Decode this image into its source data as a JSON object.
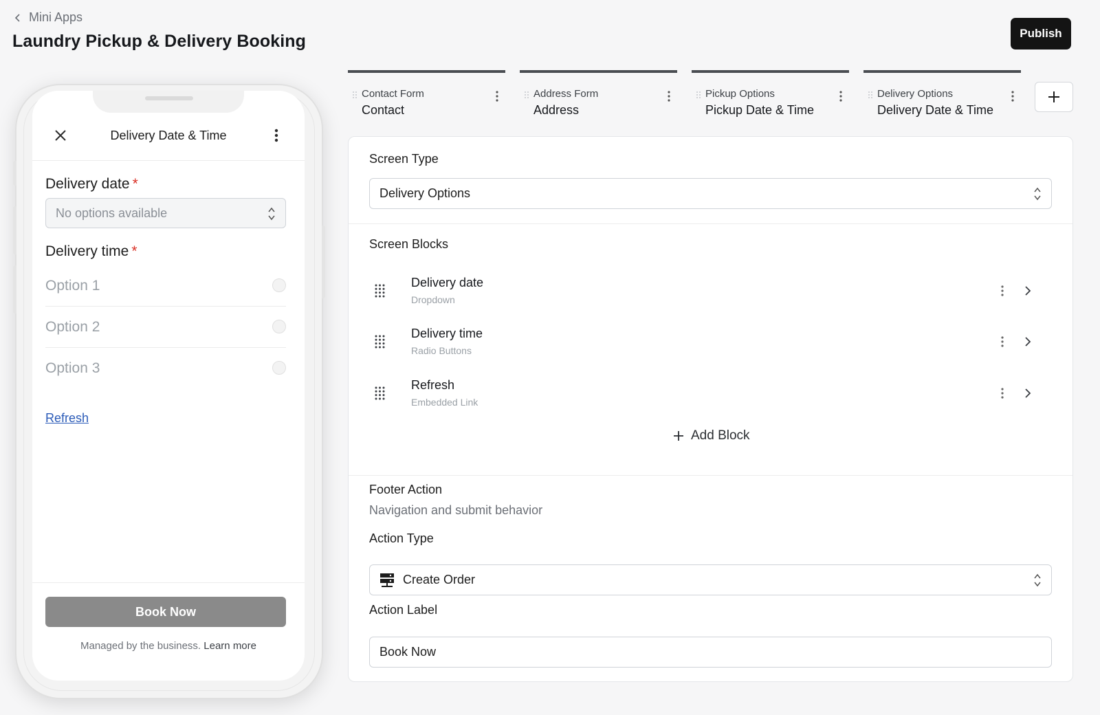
{
  "header": {
    "breadcrumb": "Mini Apps",
    "title": "Laundry Pickup & Delivery Booking",
    "publish_label": "Publish"
  },
  "phone": {
    "screen_title": "Delivery Date & Time",
    "delivery_date": {
      "label": "Delivery date",
      "required_mark": "*",
      "placeholder": "No options available"
    },
    "delivery_time": {
      "label": "Delivery time",
      "required_mark": "*",
      "options": [
        "Option 1",
        "Option 2",
        "Option 3"
      ]
    },
    "refresh_link": "Refresh",
    "book_button": "Book Now",
    "managed_text": "Managed by the business.",
    "learn_more": "Learn more"
  },
  "tabs": [
    {
      "sub": "Contact Form",
      "main": "Contact"
    },
    {
      "sub": "Address Form",
      "main": "Address"
    },
    {
      "sub": "Pickup Options",
      "main": "Pickup Date & Time"
    },
    {
      "sub": "Delivery Options",
      "main": "Delivery Date & Time"
    }
  ],
  "editor": {
    "screen_type_label": "Screen Type",
    "screen_type_value": "Delivery Options",
    "screen_blocks_label": "Screen Blocks",
    "blocks": [
      {
        "title": "Delivery date",
        "type": "Dropdown"
      },
      {
        "title": "Delivery time",
        "type": "Radio Buttons"
      },
      {
        "title": "Refresh",
        "type": "Embedded Link"
      }
    ],
    "add_block_label": "Add Block",
    "footer_action_label": "Footer Action",
    "footer_action_desc": "Navigation and submit behavior",
    "action_type_label": "Action Type",
    "action_type_value": "Create Order",
    "action_label_label": "Action Label",
    "action_label_value": "Book Now"
  }
}
